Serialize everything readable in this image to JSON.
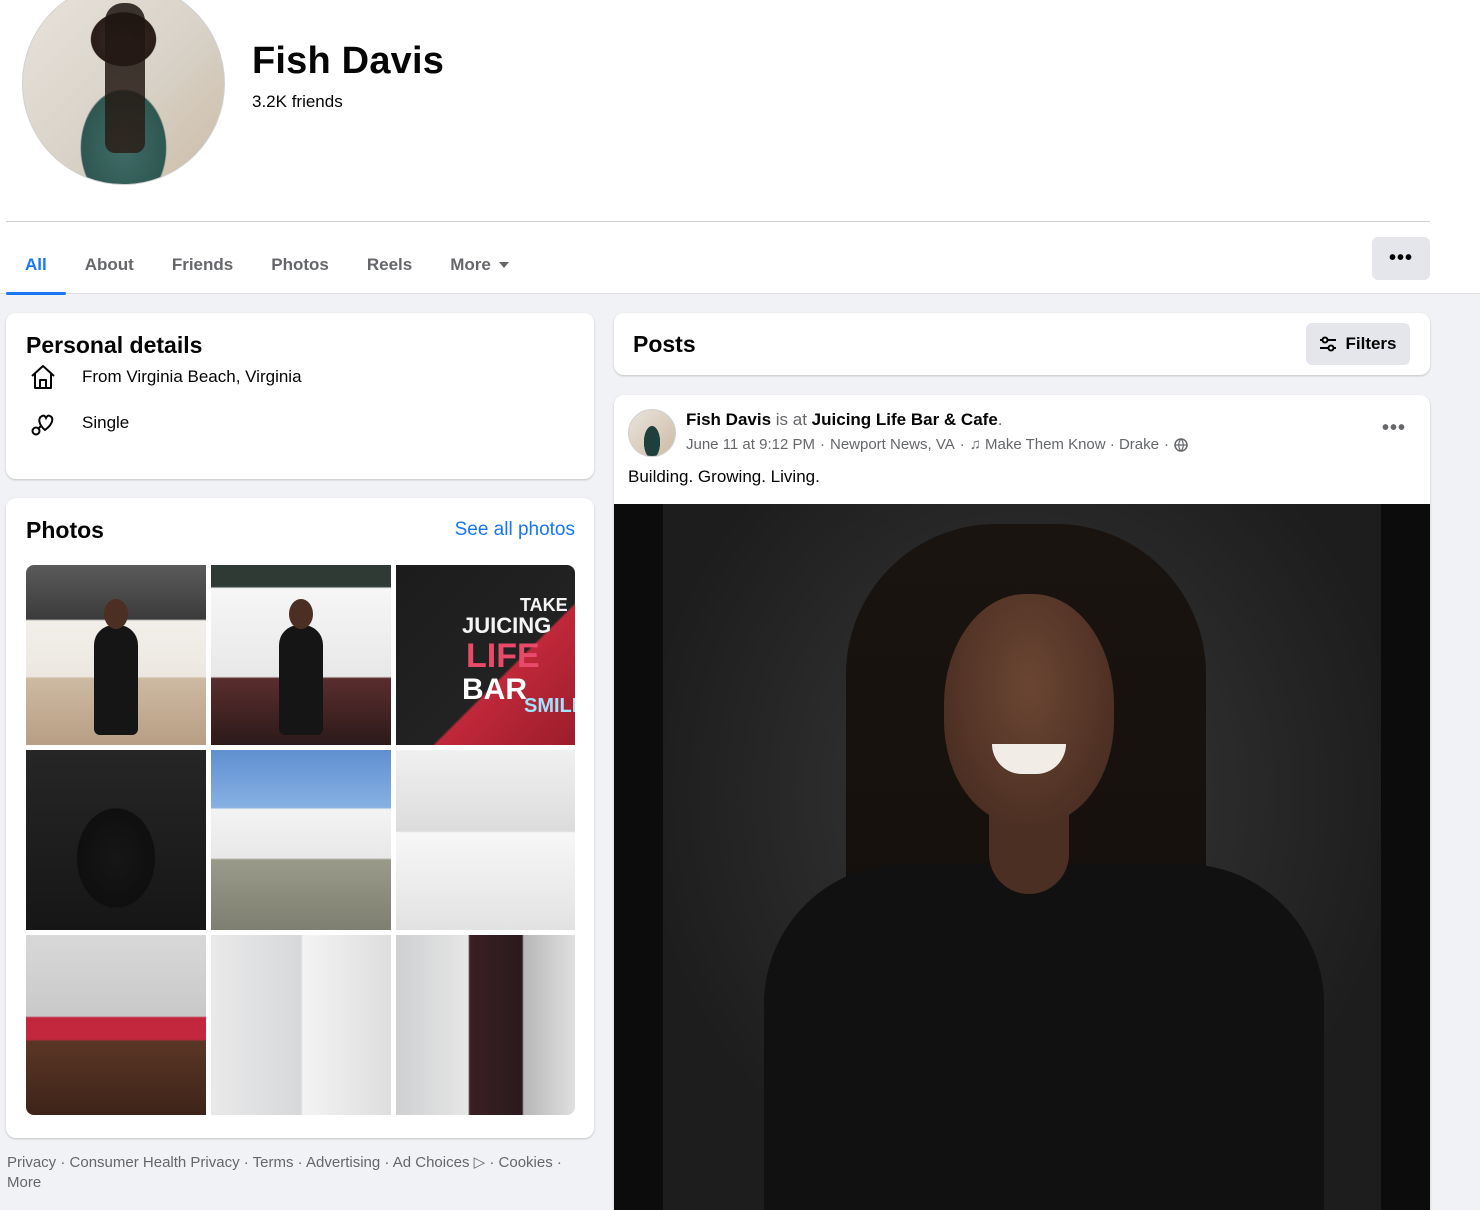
{
  "profile": {
    "name": "Fish Davis",
    "friends": "3.2K friends"
  },
  "tabs": [
    {
      "label": "All",
      "active": true
    },
    {
      "label": "About"
    },
    {
      "label": "Friends"
    },
    {
      "label": "Photos"
    },
    {
      "label": "Reels"
    },
    {
      "label": "More"
    }
  ],
  "header_more": "•••",
  "personal_details": {
    "title": "Personal details",
    "items": [
      {
        "icon": "home-icon",
        "text": "From Virginia Beach, Virginia"
      },
      {
        "icon": "heart-icon",
        "text": "Single"
      }
    ]
  },
  "photos_card": {
    "title": "Photos",
    "see_all": "See all photos",
    "photo3_text": [
      "JUICING",
      "LIFE",
      "BAR",
      "TAKE",
      "SMILE!"
    ]
  },
  "footer": {
    "links": [
      "Privacy",
      "Consumer Health Privacy",
      "Terms",
      "Advertising",
      "Ad Choices",
      "Cookies",
      "More"
    ],
    "sep": " · ",
    "ad_choices_icon": "▷"
  },
  "posts": {
    "title": "Posts",
    "filters_label": "Filters"
  },
  "post": {
    "author": "Fish Davis",
    "is_at": " is at ",
    "place": "Juicing Life Bar & Cafe",
    "period": ".",
    "date": "June 11 at 9:12 PM",
    "location": "Newport News, VA",
    "music_icon": "♫",
    "song": "Make Them Know · Drake",
    "audience_icon": "globe-icon",
    "text": "Building. Growing. Living.",
    "menu": "•••"
  },
  "colors": {
    "accent": "#1877f2",
    "secondary_text": "#65676b",
    "page_bg": "#f0f2f5"
  }
}
